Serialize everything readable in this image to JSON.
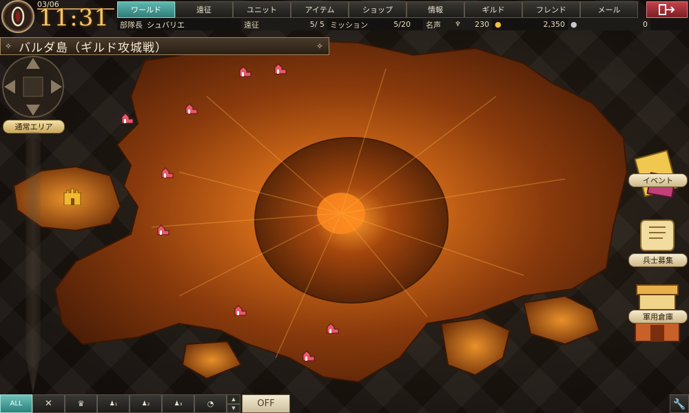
{
  "clock": {
    "date": "03/06",
    "time": "11:31"
  },
  "tabs": [
    {
      "label": "ワールド",
      "active": true
    },
    {
      "label": "遠征",
      "active": false
    },
    {
      "label": "ユニット",
      "active": false
    },
    {
      "label": "アイテム",
      "active": false
    },
    {
      "label": "ショップ",
      "active": false
    },
    {
      "label": "情報",
      "active": false
    },
    {
      "label": "ギルド",
      "active": false
    },
    {
      "label": "フレンド",
      "active": false
    },
    {
      "label": "メール",
      "active": false
    }
  ],
  "info": {
    "unit_leader_label": "部隊長",
    "unit_leader_name": "シュバリエ",
    "expedition_label": "遠征",
    "expedition_value": "5/ 5",
    "mission_label": "ミッション",
    "mission_value": "5/20",
    "fame_label": "名声",
    "fame_value": "230",
    "gold_value": "2,350",
    "orb_value": "0"
  },
  "map_title": "バルダ島（ギルド攻城戦）",
  "area_button": "通常エリア",
  "side_buttons": {
    "event": "イベント",
    "recruit": "兵士募集",
    "warehouse": "軍用倉庫"
  },
  "filters": {
    "all": "ALL",
    "off": "OFF"
  },
  "colors": {
    "tab_active": "#2f7c78",
    "lava": "#e07820",
    "marker": "#e85a6a",
    "castle": "#f2b830"
  }
}
